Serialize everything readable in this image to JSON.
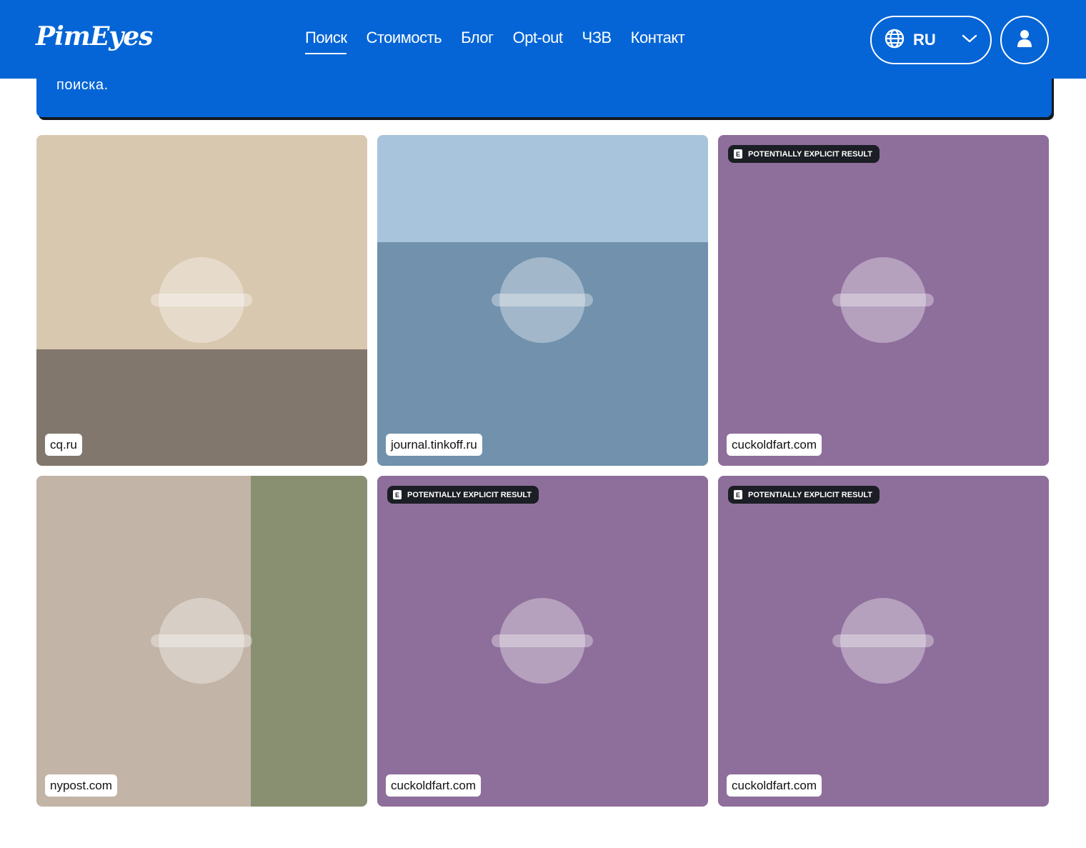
{
  "header": {
    "logo_text": "PimEyes",
    "nav": [
      {
        "label": "Поиск",
        "active": true
      },
      {
        "label": "Стоимость",
        "active": false
      },
      {
        "label": "Блог",
        "active": false
      },
      {
        "label": "Opt-out",
        "active": false
      },
      {
        "label": "ЧЗВ",
        "active": false
      },
      {
        "label": "Контакт",
        "active": false
      }
    ],
    "language": {
      "selected": "RU",
      "icon": "globe-icon",
      "dropdown_icon": "chevron-down-icon"
    },
    "user_icon": "user-icon"
  },
  "notice": {
    "text": "поиска."
  },
  "results": [
    {
      "source": "cq.ru",
      "explicit": false
    },
    {
      "source": "journal.tinkoff.ru",
      "explicit": false
    },
    {
      "source": "cuckoldfart.com",
      "explicit": true
    },
    {
      "source": "nypost.com",
      "explicit": false
    },
    {
      "source": "cuckoldfart.com",
      "explicit": true
    },
    {
      "source": "cuckoldfart.com",
      "explicit": true
    }
  ],
  "explicit_badge": {
    "letter": "E",
    "label": "Potentially explicit result"
  },
  "colors": {
    "brand": "#0565d6",
    "text_on_brand": "#ffffff",
    "badge_bg": "#1b1e24"
  }
}
